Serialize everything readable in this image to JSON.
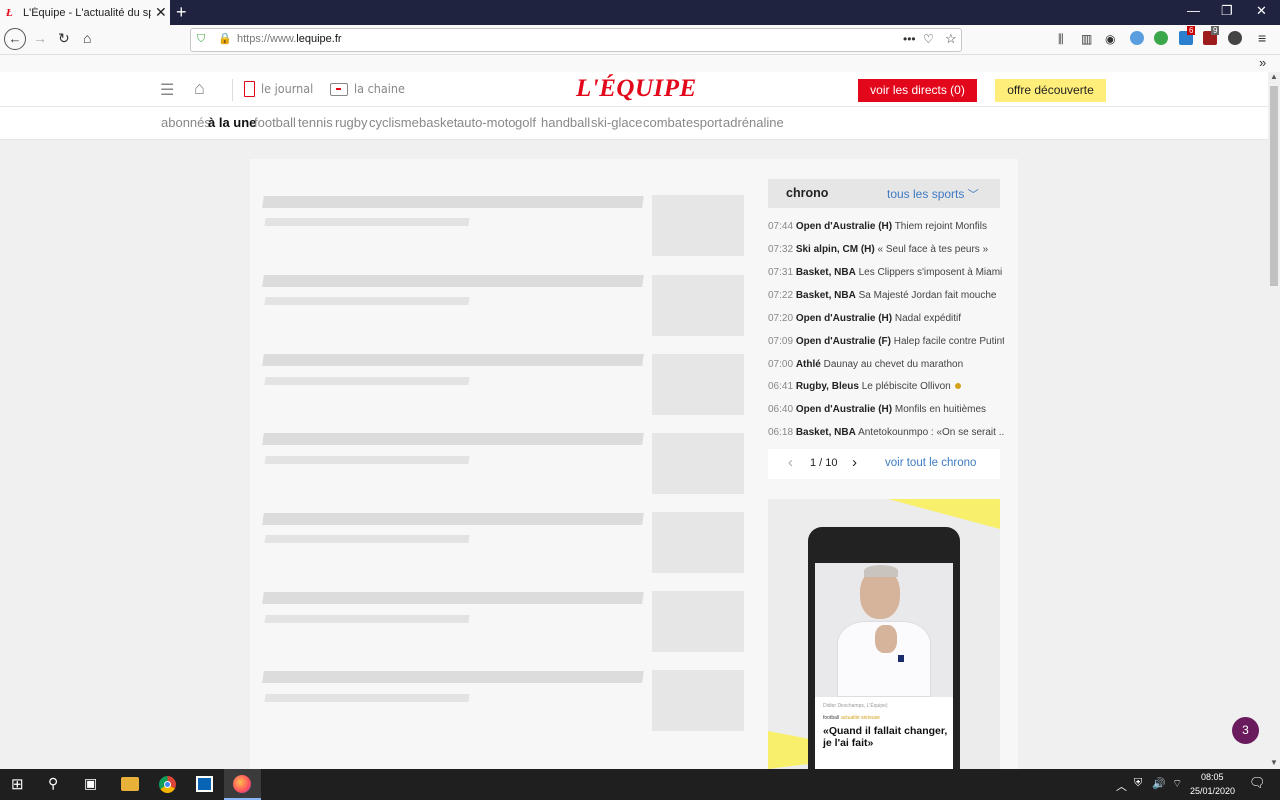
{
  "browser": {
    "tab_title": "L'Équipe - L'actualité du sport e",
    "tab_favicon": "Ł",
    "new_tab": "+",
    "url_prefix": "https://www.",
    "url_domain": "lequipe.fr",
    "ext_badge_1": "6",
    "ext_badge_2": "9"
  },
  "header": {
    "le_journal": "le journal",
    "la_chaine": "la chaine",
    "logo": "L'ÉQUIPE",
    "voir_directs": "voir les directs (0)",
    "offre": "offre découverte"
  },
  "categories": [
    "abonnés",
    "à la une",
    "football",
    "tennis",
    "rugby",
    "cyclisme",
    "basket",
    "auto-moto",
    "golf",
    "handball",
    "ski-glace",
    "combat",
    "esport",
    "adrénaline"
  ],
  "chrono": {
    "title": "chrono",
    "filter": "tous les sports",
    "items": [
      {
        "time": "07:44",
        "cat": "Open d'Australie (H)",
        "headline": "Thiem rejoint Monfils"
      },
      {
        "time": "07:32",
        "cat": "Ski alpin, CM (H)",
        "headline": "« Seul face à tes peurs »"
      },
      {
        "time": "07:31",
        "cat": "Basket, NBA",
        "headline": "Les Clippers s'imposent à Miami"
      },
      {
        "time": "07:22",
        "cat": "Basket, NBA",
        "headline": "Sa Majesté Jordan fait mouche"
      },
      {
        "time": "07:20",
        "cat": "Open d'Australie (H)",
        "headline": "Nadal expéditif"
      },
      {
        "time": "07:09",
        "cat": "Open d'Australie (F)",
        "headline": "Halep facile contre Putint..."
      },
      {
        "time": "07:00",
        "cat": "Athlé",
        "headline": "Daunay au chevet du marathon"
      },
      {
        "time": "06:41",
        "cat": "Rugby, Bleus",
        "headline": "Le plébiscite Ollivon"
      },
      {
        "time": "06:40",
        "cat": "Open d'Australie (H)",
        "headline": "Monfils en huitièmes"
      },
      {
        "time": "06:18",
        "cat": "Basket, NBA",
        "headline": "Antetokounmpo : «On se serait ..."
      }
    ],
    "page": "1 / 10",
    "voir_tout": "voir tout le chrono"
  },
  "ad": {
    "caption": "Didier Deschamps, L'Équipe)",
    "sport": "football",
    "tag": "actualité sérieuse",
    "quote": "«Quand il fallait changer, je l'ai fait»"
  },
  "notification_badge": "3",
  "taskbar": {
    "time": "08:05",
    "date": "25/01/2020"
  }
}
